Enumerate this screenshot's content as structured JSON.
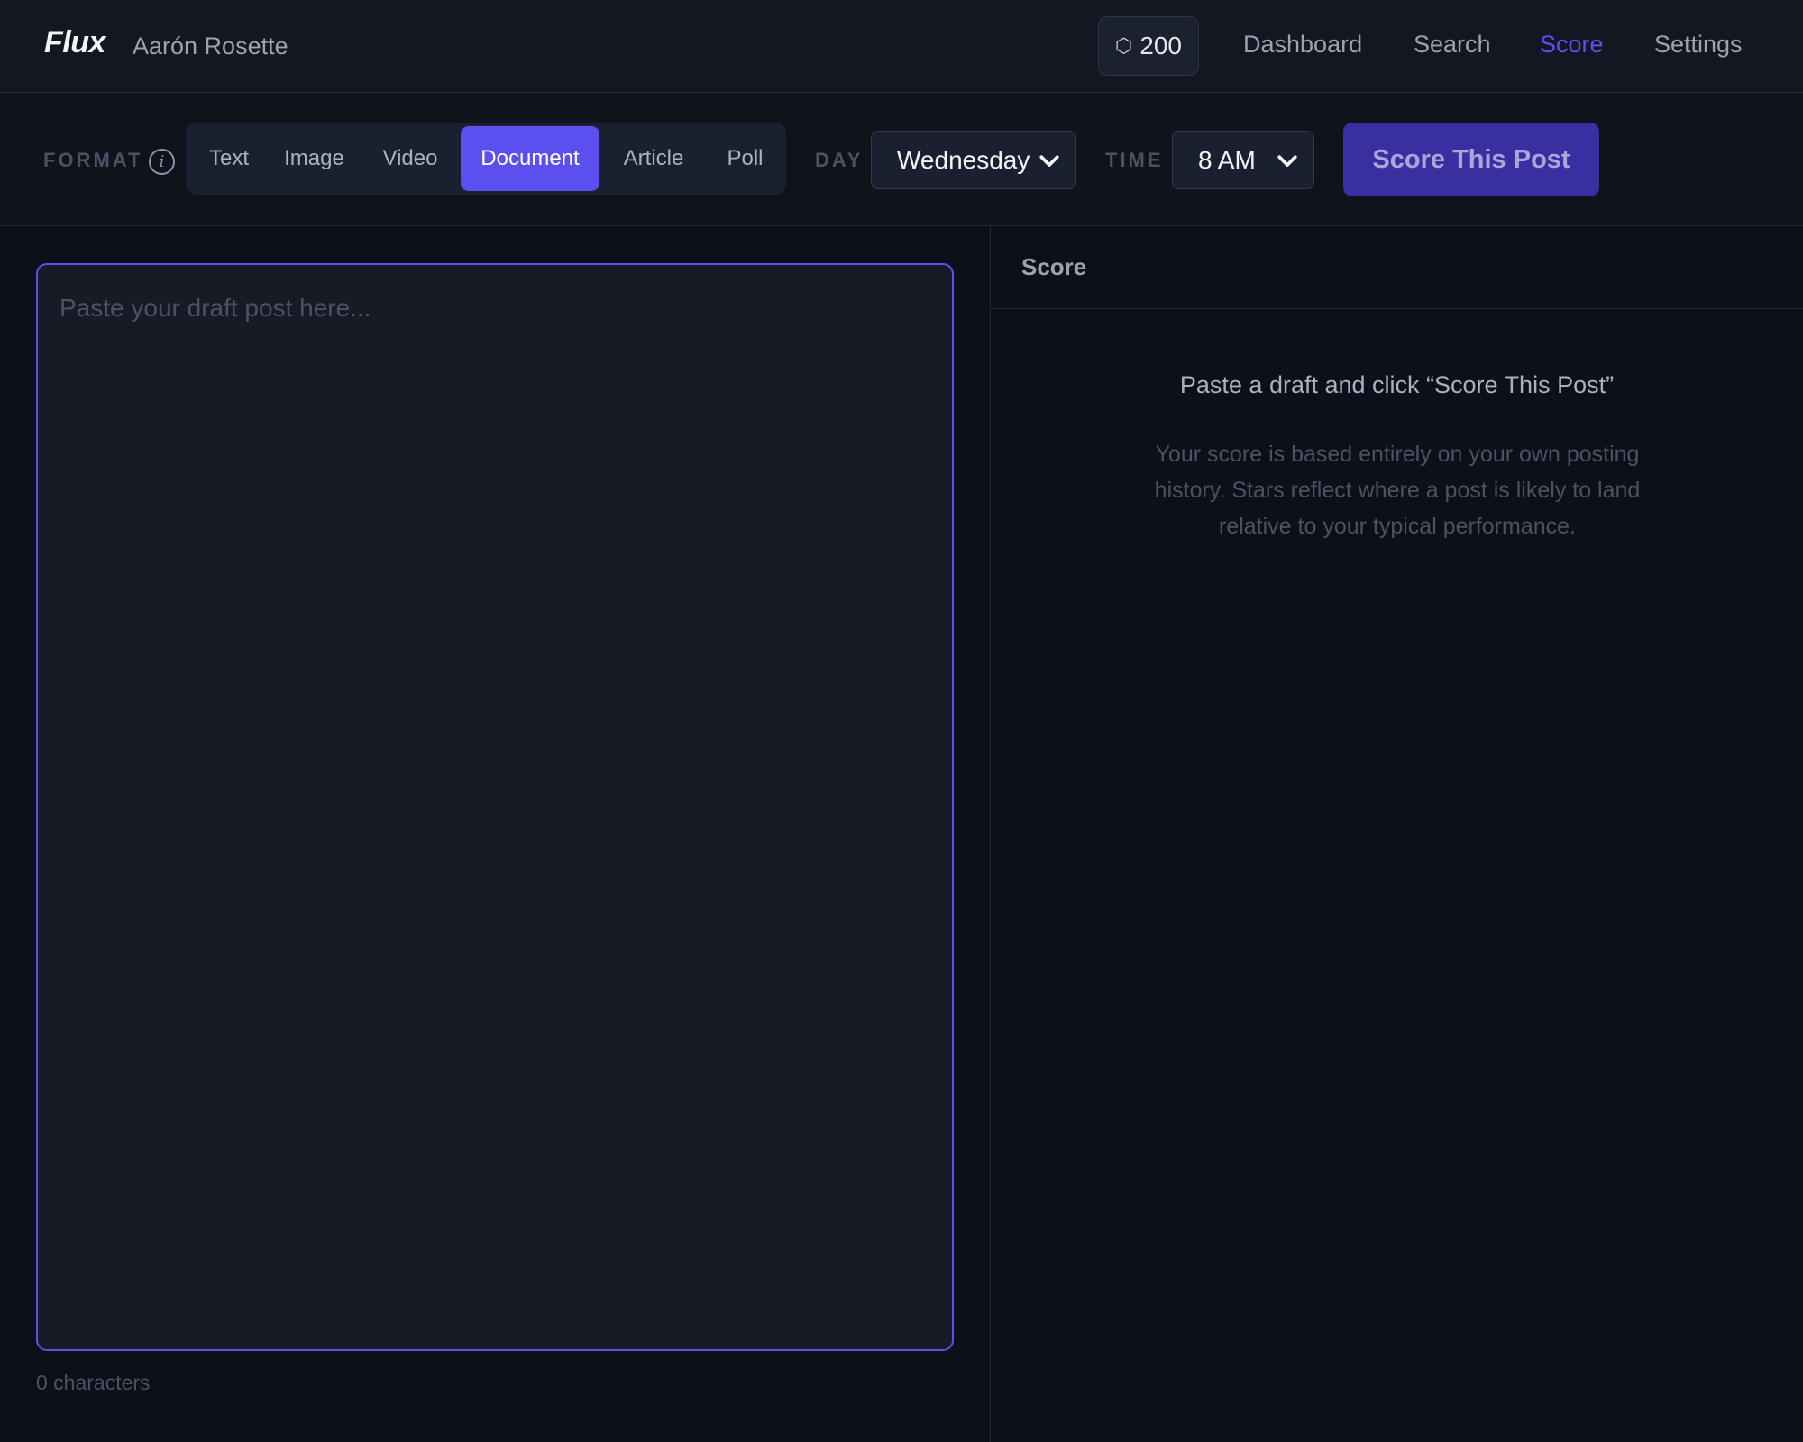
{
  "header": {
    "brand": "Flux",
    "user_name": "Aarón Rosette",
    "credits_icon": "hexagon-icon",
    "credits": "200",
    "nav": [
      {
        "label": "Dashboard",
        "active": false
      },
      {
        "label": "Search",
        "active": false
      },
      {
        "label": "Score",
        "active": true
      },
      {
        "label": "Settings",
        "active": false
      }
    ]
  },
  "controls": {
    "format_label": "FORMAT",
    "info_icon_glyph": "i",
    "formats": [
      "Text",
      "Image",
      "Video",
      "Document",
      "Article",
      "Poll"
    ],
    "selected_format": "Document",
    "day_label": "DAY",
    "day_value": "Wednesday",
    "time_label": "TIME",
    "time_value": "8 AM",
    "score_button": "Score This Post"
  },
  "editor": {
    "placeholder": "Paste your draft post here...",
    "value": "",
    "char_count": "0 characters"
  },
  "panel": {
    "title": "Score",
    "empty_title": "Paste a draft and click “Score This Post”",
    "empty_desc": "Your score is based entirely on your own posting history. Stars reflect where a post is likely to land relative to your typical performance."
  },
  "colors": {
    "accent": "#5b4ff0",
    "button_bg": "#3a2fa0",
    "background": "#0c1018",
    "topbar": "#131722"
  }
}
